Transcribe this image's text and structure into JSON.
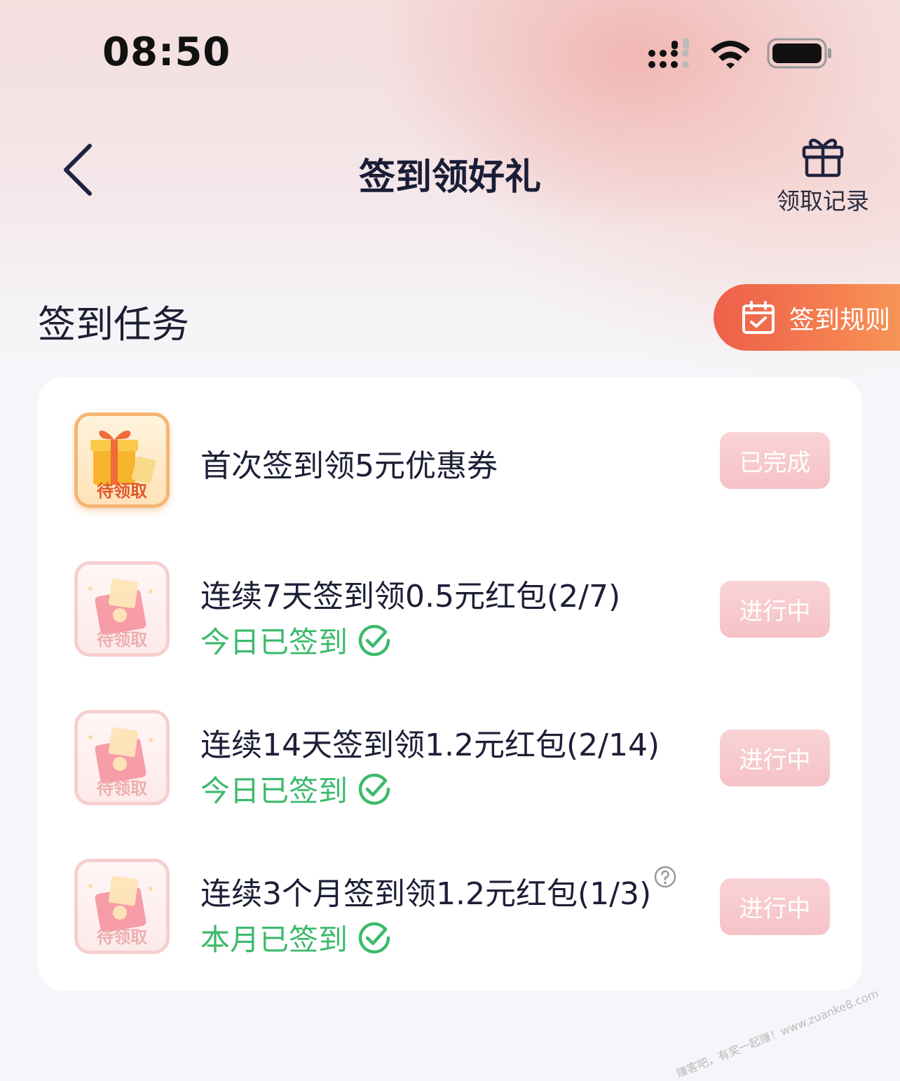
{
  "status_bar": {
    "time": "08:50"
  },
  "header": {
    "title": "签到领好礼",
    "records_label": "领取记录"
  },
  "section": {
    "title": "签到任务",
    "rules_label": "签到规则"
  },
  "tasks": [
    {
      "title": "首次签到领5元优惠券",
      "tag": "待领取",
      "subtitle": "",
      "status": "已完成",
      "thumb": "gift-box",
      "has_help": false
    },
    {
      "title": "连续7天签到领0.5元红包(2/7)",
      "tag": "待领取",
      "subtitle": "今日已签到",
      "status": "进行中",
      "thumb": "red-envelope",
      "has_help": false
    },
    {
      "title": "连续14天签到领1.2元红包(2/14)",
      "tag": "待领取",
      "subtitle": "今日已签到",
      "status": "进行中",
      "thumb": "red-envelope",
      "has_help": false
    },
    {
      "title": "连续3个月签到领1.2元红包(1/3)",
      "tag": "待领取",
      "subtitle": "本月已签到",
      "status": "进行中",
      "thumb": "red-envelope",
      "has_help": true
    }
  ],
  "watermark": "赚客吧，有奖一起赚！www.zuanke8.com",
  "colors": {
    "accent": "#ee5f4a",
    "success": "#3cba6c",
    "title": "#1c1f36",
    "status_button": "#f6c8cc"
  }
}
